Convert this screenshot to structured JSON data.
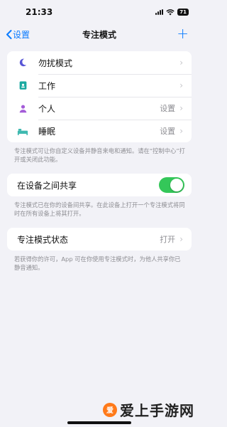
{
  "status_bar": {
    "time": "21:33",
    "battery": "71"
  },
  "nav": {
    "back_label": "设置",
    "title": "专注模式",
    "add_label": "+"
  },
  "modes": [
    {
      "label": "勿扰模式",
      "value": "",
      "icon": "moon-icon",
      "color": "#5856d6"
    },
    {
      "label": "工作",
      "value": "",
      "icon": "work-badge-icon",
      "color": "#1aa9a0"
    },
    {
      "label": "个人",
      "value": "设置",
      "icon": "person-icon",
      "color": "#a45cd8"
    },
    {
      "label": "睡眠",
      "value": "设置",
      "icon": "bed-icon",
      "color": "#3fb9b0"
    }
  ],
  "modes_note": "专注模式可让你自定义设备并静音来电和通知。请在“控制中心”打开或关闭此功能。",
  "share": {
    "label": "在设备之间共享",
    "enabled": true,
    "note": "专注模式已在你的设备间共享。在此设备上打开一个专注模式将同时在所有设备上将其打开。"
  },
  "focus_status": {
    "label": "专注模式状态",
    "value": "打开",
    "note": "若获得你的许可，App 可在你使用专注模式时，为他人共享你已静音通知。"
  },
  "watermark": {
    "text": "爱上手游网",
    "logo_text": "爱"
  },
  "colors": {
    "accent": "#0a7bff",
    "toggle_on": "#34c759"
  }
}
